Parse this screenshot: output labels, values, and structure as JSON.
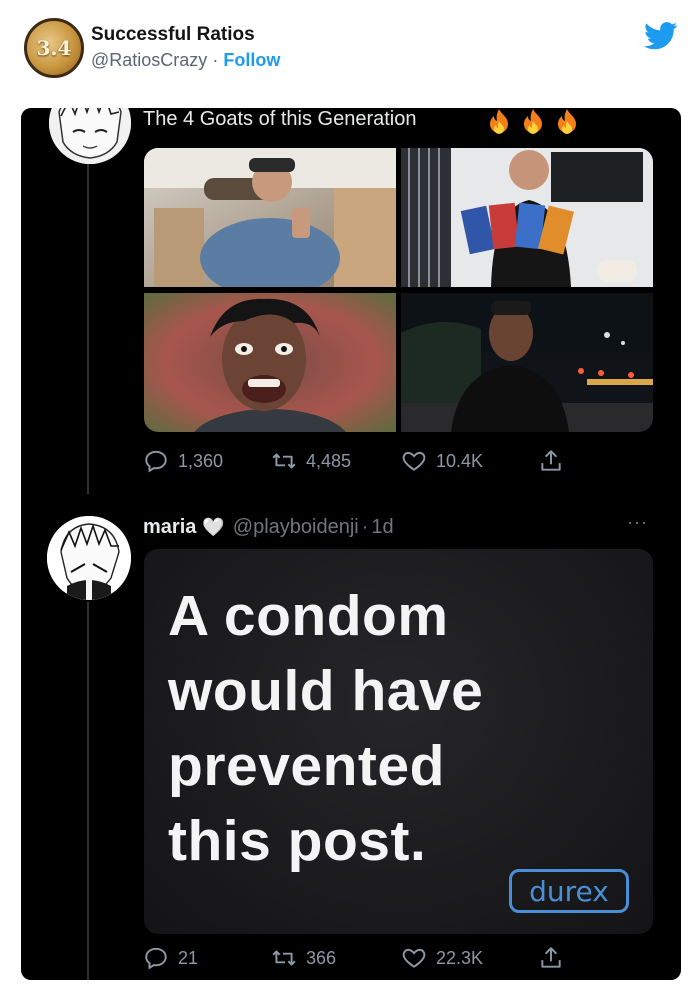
{
  "embed": {
    "avatar_text": "3.4",
    "account_name": "Successful Ratios",
    "handle": "@RatiosCrazy",
    "separator": "·",
    "follow_label": "Follow",
    "platform_icon": "twitter-bird-icon"
  },
  "top_tweet": {
    "text": "The 4 Goats of this Generation",
    "emoji": [
      "fire-icon",
      "fire-icon",
      "fire-icon"
    ],
    "photo_grid": [
      "private-jet-photo",
      "game-boxes-photo",
      "shouting-face-photo",
      "night-street-photo"
    ],
    "actions": {
      "replies": "1,360",
      "retweets": "4,485",
      "likes": "10.4K"
    }
  },
  "reply_tweet": {
    "display_name": "maria",
    "name_decoration": "🤍",
    "handle": "@playboidenji",
    "separator": "·",
    "time": "1d",
    "more_icon": "···",
    "ad_lines": [
      "A condom",
      "would have",
      "prevented",
      "this post."
    ],
    "brand": "durex",
    "actions": {
      "replies": "21",
      "retweets": "366",
      "likes": "22.3K"
    }
  },
  "colors": {
    "accent": "#1d9bf0",
    "card_bg": "#000000",
    "muted": "#8b98a5",
    "durex_blue": "#4a8ed6"
  }
}
